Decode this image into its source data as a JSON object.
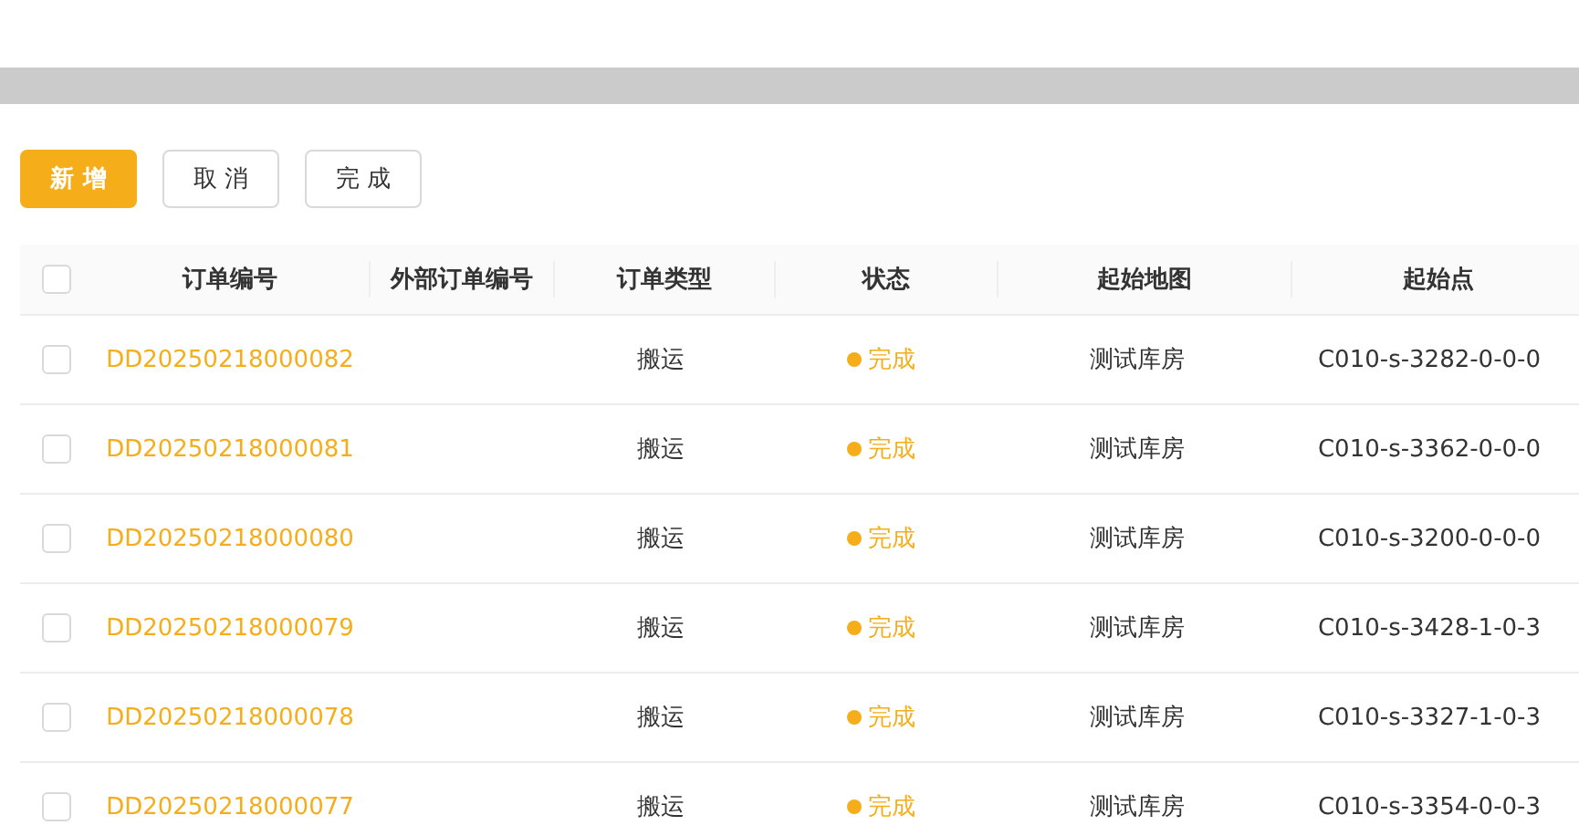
{
  "toolbar": {
    "buttons": [
      {
        "label": "新 增",
        "kind": "primary"
      },
      {
        "label": "取 消",
        "kind": "default"
      },
      {
        "label": "完 成",
        "kind": "default"
      }
    ]
  },
  "table": {
    "select_all": {
      "checked": false
    },
    "columns": [
      "订单编号",
      "外部订单编号",
      "订单类型",
      "状态",
      "起始地图",
      "起始点"
    ],
    "rows": [
      {
        "checked": false,
        "order_no": "DD20250218000082",
        "type": "搬运",
        "status": "完成",
        "map": "测试库房",
        "start": "C010-s-3282-0-0-0"
      },
      {
        "checked": false,
        "order_no": "DD20250218000081",
        "type": "搬运",
        "status": "完成",
        "map": "测试库房",
        "start": "C010-s-3362-0-0-0"
      },
      {
        "checked": false,
        "order_no": "DD20250218000080",
        "type": "搬运",
        "status": "完成",
        "map": "测试库房",
        "start": "C010-s-3200-0-0-0"
      },
      {
        "checked": false,
        "order_no": "DD20250218000079",
        "type": "搬运",
        "status": "完成",
        "map": "测试库房",
        "start": "C010-s-3428-1-0-3"
      },
      {
        "checked": false,
        "order_no": "DD20250218000078",
        "type": "搬运",
        "status": "完成",
        "map": "测试库房",
        "start": "C010-s-3327-1-0-3"
      },
      {
        "checked": false,
        "order_no": "DD20250218000077",
        "type": "搬运",
        "status": "完成",
        "map": "测试库房",
        "start": "C010-s-3354-0-0-3"
      }
    ]
  }
}
